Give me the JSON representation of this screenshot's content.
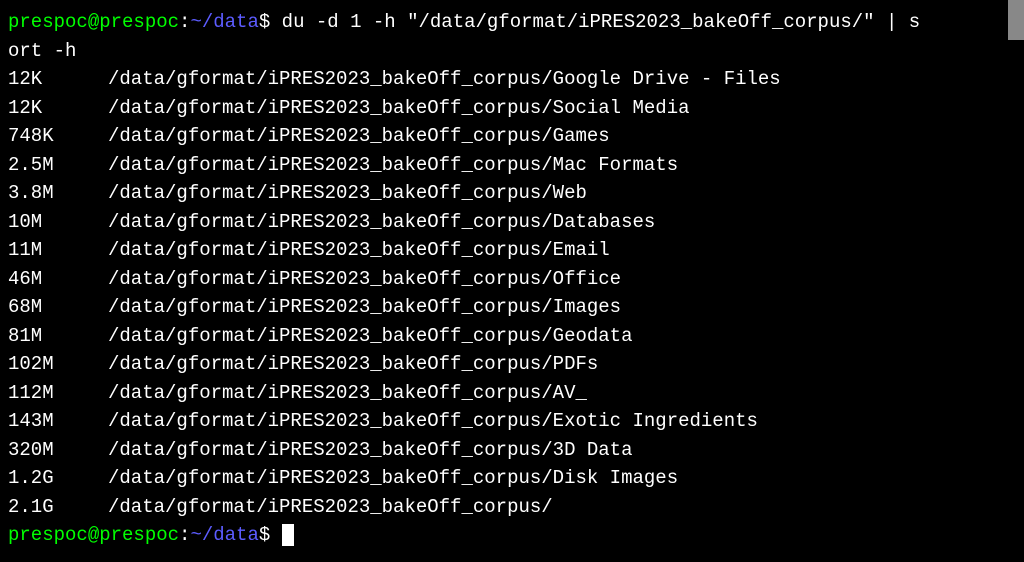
{
  "prompt": {
    "user_host": "prespoc@prespoc",
    "separator": ":",
    "path": "~/data",
    "symbol": "$"
  },
  "command": {
    "line1": "du -d 1 -h \"/data/gformat/iPRES2023_bakeOff_corpus/\" | s",
    "line2": "ort -h"
  },
  "output": [
    {
      "size": "12K",
      "path": "/data/gformat/iPRES2023_bakeOff_corpus/Google Drive - Files"
    },
    {
      "size": "12K",
      "path": "/data/gformat/iPRES2023_bakeOff_corpus/Social Media"
    },
    {
      "size": "748K",
      "path": "/data/gformat/iPRES2023_bakeOff_corpus/Games"
    },
    {
      "size": "2.5M",
      "path": "/data/gformat/iPRES2023_bakeOff_corpus/Mac Formats"
    },
    {
      "size": "3.8M",
      "path": "/data/gformat/iPRES2023_bakeOff_corpus/Web"
    },
    {
      "size": "10M",
      "path": "/data/gformat/iPRES2023_bakeOff_corpus/Databases"
    },
    {
      "size": "11M",
      "path": "/data/gformat/iPRES2023_bakeOff_corpus/Email"
    },
    {
      "size": "46M",
      "path": "/data/gformat/iPRES2023_bakeOff_corpus/Office"
    },
    {
      "size": "68M",
      "path": "/data/gformat/iPRES2023_bakeOff_corpus/Images"
    },
    {
      "size": "81M",
      "path": "/data/gformat/iPRES2023_bakeOff_corpus/Geodata"
    },
    {
      "size": "102M",
      "path": "/data/gformat/iPRES2023_bakeOff_corpus/PDFs"
    },
    {
      "size": "112M",
      "path": "/data/gformat/iPRES2023_bakeOff_corpus/AV_"
    },
    {
      "size": "143M",
      "path": "/data/gformat/iPRES2023_bakeOff_corpus/Exotic Ingredients"
    },
    {
      "size": "320M",
      "path": "/data/gformat/iPRES2023_bakeOff_corpus/3D Data"
    },
    {
      "size": "1.2G",
      "path": "/data/gformat/iPRES2023_bakeOff_corpus/Disk Images"
    },
    {
      "size": "2.1G",
      "path": "/data/gformat/iPRES2023_bakeOff_corpus/"
    }
  ]
}
